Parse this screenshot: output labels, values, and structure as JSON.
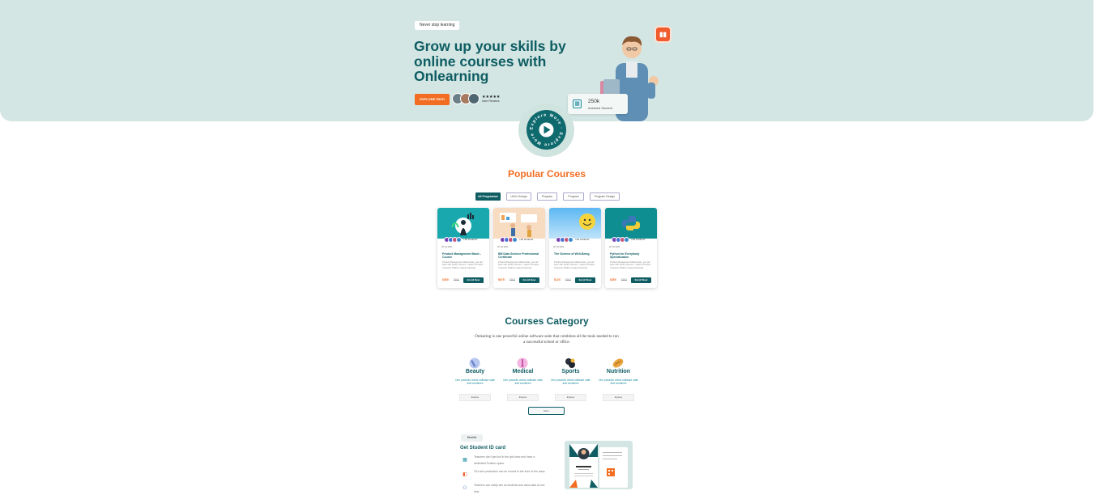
{
  "hero": {
    "tag": "Never stop learning",
    "title": "Grow up your skills by online courses with Onlearning",
    "explore_button": "EXPLORE PATH",
    "stars": "★★★★★",
    "rating_label": "User Reviews",
    "stat_number": "250k",
    "stat_label": "Assisted Student",
    "play_ring_text": "Explore More · Explore More ·"
  },
  "popular": {
    "title": "Popular Courses",
    "filters": [
      "All Programme",
      "Ui/Ux Design",
      "Program",
      "Program",
      "Program Design"
    ],
    "cards": [
      {
        "date": "20 Jul 2021",
        "title": "Product Management Basic - Course",
        "desc": "Product Management Masterclass, you will learn with Sarah Johnson - Head of Product Customer Platform Gojek Indonesia.",
        "price": "$380",
        "old": "$500",
        "cta": "Enroll Now",
        "students": "+40 students"
      },
      {
        "date": "20 Jul 2021",
        "title": "BM Data Science Professional Certificate",
        "desc": "Product Management Masterclass, you will learn with Sarah Johnson - Head of Product Customer Platform Gojek Indonesia.",
        "price": "$678",
        "old": "$500",
        "cta": "Enroll Now",
        "students": "+40 students"
      },
      {
        "date": "20 Jul 2021",
        "title": "The Science of Well-Being",
        "desc": "Product Management Masterclass, you will learn with Sarah Johnson - Head of Product Customer Platform Gojek Indonesia.",
        "price": "$123",
        "old": "$500",
        "cta": "Enroll Now",
        "students": "+40 students"
      },
      {
        "date": "20 Jul 2021",
        "title": "Python for Everybody Specialization",
        "desc": "Product Management Masterclass, you will learn with Sarah Johnson - Head of Product Customer Platform Gojek Indonesia.",
        "price": "$380",
        "old": "$500",
        "cta": "Enroll Now",
        "students": "+40 students"
      }
    ]
  },
  "category": {
    "title": "Courses Category",
    "subtitle": "Onlearing is one powerful online software suite that combines all the tools needed to run a successful school or office.",
    "items": [
      {
        "name": "Beauty",
        "desc": "One powerful online software suite that combines",
        "cta": "Explore"
      },
      {
        "name": "Medical",
        "desc": "One powerful online software suite that combines",
        "cta": "Explore"
      },
      {
        "name": "Sports",
        "desc": "One powerful online software suite that combines",
        "cta": "Explore"
      },
      {
        "name": "Nutrition",
        "desc": "One powerful online software suite that combines",
        "cta": "Explore"
      }
    ],
    "more": "More"
  },
  "benefits": {
    "tag": "Benefits",
    "title": "Get Student ID card",
    "items": [
      "Teachers don't get lost in the grid view and have a dedicated Podium space.",
      "TA's and presenters can be moved to the front of the class.",
      "Teachers can easily see all students and class data at one time."
    ]
  }
}
